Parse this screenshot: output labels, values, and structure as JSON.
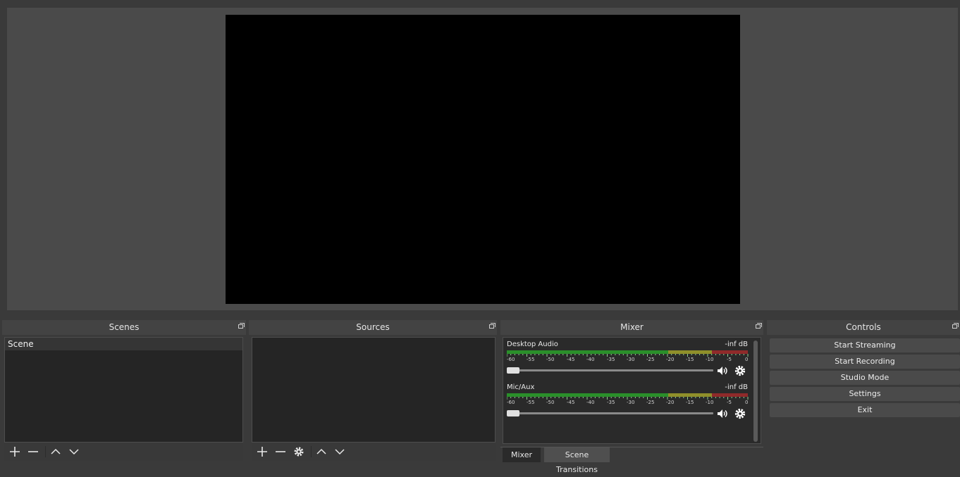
{
  "docks": {
    "scenes_title": "Scenes",
    "sources_title": "Sources",
    "mixer_title": "Mixer",
    "controls_title": "Controls"
  },
  "scenes": {
    "items": [
      "Scene"
    ]
  },
  "mixer": {
    "channels": [
      {
        "name": "Desktop Audio",
        "level": "-inf dB",
        "volume_fraction": 0.0
      },
      {
        "name": "Mic/Aux",
        "level": "-inf dB",
        "volume_fraction": 0.0
      }
    ],
    "scale": [
      "-60",
      "-55",
      "-50",
      "-45",
      "-40",
      "-35",
      "-30",
      "-25",
      "-20",
      "-15",
      "-10",
      "-5",
      "0"
    ],
    "tabs": [
      "Mixer",
      "Scene Transitions"
    ]
  },
  "controls": {
    "buttons": [
      "Start Streaming",
      "Start Recording",
      "Studio Mode",
      "Settings",
      "Exit"
    ]
  },
  "icons": {
    "add": "plus-icon",
    "remove": "minus-icon",
    "up": "chevron-up-icon",
    "down": "chevron-down-icon",
    "properties": "gear-icon",
    "volume": "speaker-icon",
    "float": "float-dock-icon"
  },
  "colors": {
    "meter_green": "#2a8f2a",
    "meter_yellow": "#8f8f2a",
    "meter_red": "#8f2a2a",
    "preview_bg": "#000000"
  }
}
